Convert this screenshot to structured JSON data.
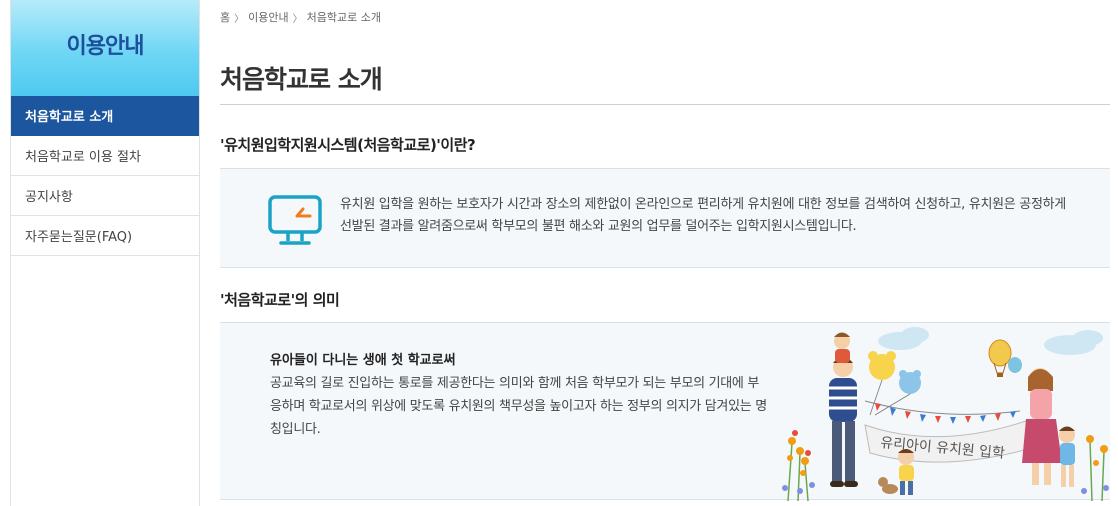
{
  "sidebar": {
    "title": "이용안내",
    "items": [
      {
        "label": "처음학교로 소개",
        "active": true
      },
      {
        "label": "처음학교로 이용 절차",
        "active": false
      },
      {
        "label": "공지사항",
        "active": false
      },
      {
        "label": "자주묻는질문(FAQ)",
        "active": false
      }
    ]
  },
  "breadcrumb": {
    "home": "홈",
    "level1": "이용안내",
    "current": "처음학교로 소개",
    "separator": "〉"
  },
  "page": {
    "title": "처음학교로 소개"
  },
  "section1": {
    "title": "'유치원입학지원시스템(처음학교로)'이란?",
    "icon": "monitor-icon",
    "text": "유치원 입학을 원하는 보호자가 시간과 장소의 제한없이 온라인으로 편리하게 유치원에 대한 정보를 검색하여 신청하고, 유치원은 공정하게 선발된 결과를 알려줌으로써 학부모의 불편 해소와 교원의 업무를 덜어주는 입학지원시스템입니다."
  },
  "section2": {
    "title": "'처음학교로'의 의미",
    "heading": "유아들이 다니는 생애 첫 학교로써",
    "text": "공교육의 길로 진입하는 통로를 제공한다는 의미와 함께 처음 학부모가 되는 부모의 기대에 부응하며 학교로서의 위상에 맞도록 유치원의 책무성을 높이고자 하는 정부의 의지가 담겨있는 명칭입니다.",
    "banner_text": "유리아이 유치원 입학"
  },
  "colors": {
    "accent": "#1b569e",
    "sidebar_title": "#1c4f9c",
    "icon_teal": "#1aa3c4",
    "icon_orange": "#f07c1e"
  }
}
